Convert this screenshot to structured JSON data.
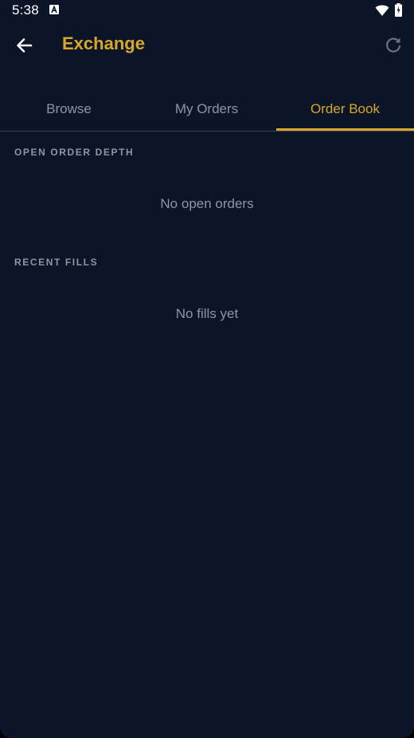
{
  "status_bar": {
    "time": "5:38",
    "icons": [
      "a-notification-icon",
      "wifi-icon",
      "battery-charging-icon"
    ]
  },
  "app_bar": {
    "title": "Exchange",
    "back_icon": "arrow-left-icon",
    "refresh_icon": "refresh-icon"
  },
  "tabs": [
    {
      "label": "Browse",
      "active": false
    },
    {
      "label": "My Orders",
      "active": false
    },
    {
      "label": "Order Book",
      "active": true
    }
  ],
  "sections": {
    "open_order_depth": {
      "header": "OPEN ORDER DEPTH",
      "empty_message": "No open orders"
    },
    "recent_fills": {
      "header": "RECENT FILLS",
      "empty_message": "No fills yet"
    }
  },
  "colors": {
    "background": "#0c1527",
    "accent": "#d6a72a",
    "muted_text": "#8e95a2",
    "divider": "#3a4150"
  }
}
